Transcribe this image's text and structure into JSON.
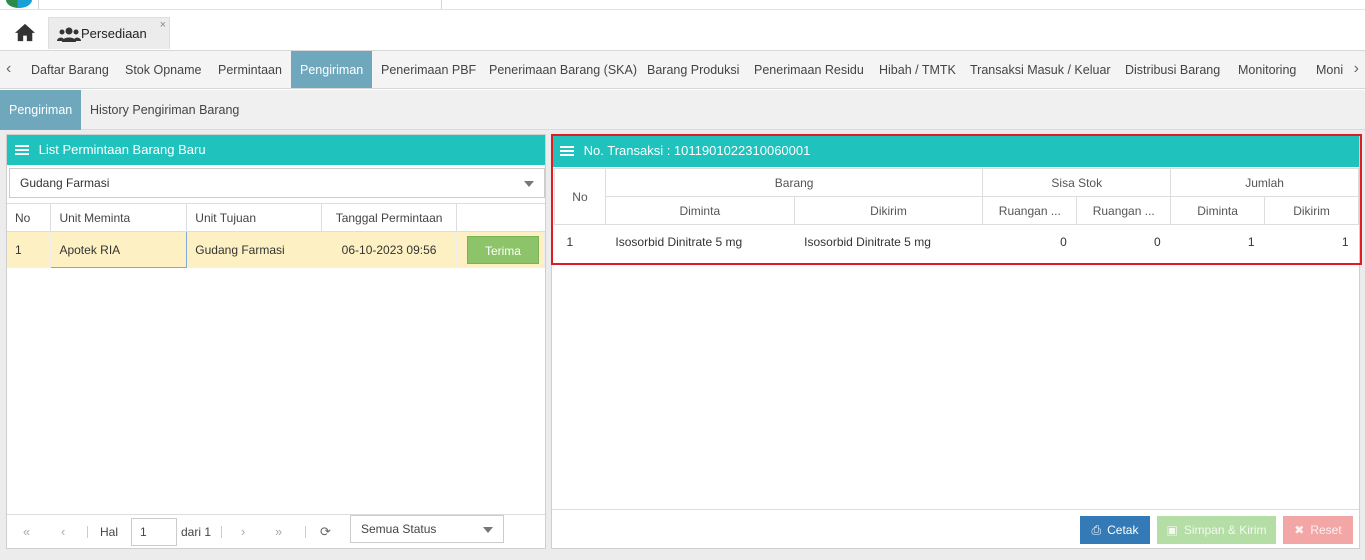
{
  "app": {
    "main_tab": {
      "label": "Persediaan",
      "close": "×"
    },
    "icons": {
      "home": "home-icon",
      "users": "users-icon",
      "close": "close-icon",
      "list": "list-icon",
      "print": "print-icon",
      "save": "save-icon",
      "reset": "close-icon"
    }
  },
  "nav": {
    "items": [
      "Daftar Barang",
      "Stok Opname",
      "Permintaan",
      "Pengiriman",
      "Penerimaan PBF",
      "Penerimaan Barang (SKA)",
      "Barang Produksi",
      "Penerimaan Residu",
      "Hibah / TMTK",
      "Transaksi Masuk / Keluar",
      "Distribusi Barang",
      "Monitoring",
      "Moni"
    ],
    "active": "Pengiriman"
  },
  "subnav": {
    "items": [
      "Pengiriman",
      "History Pengiriman Barang"
    ],
    "active": "Pengiriman"
  },
  "left_panel": {
    "title": "List Permintaan Barang Baru",
    "warehouse_select": "Gudang Farmasi",
    "columns": [
      "No",
      "Unit Meminta",
      "Unit Tujuan",
      "Tanggal Permintaan",
      ""
    ],
    "rows": [
      {
        "no": "1",
        "unit_meminta": "Apotek RIA",
        "unit_tujuan": "Gudang Farmasi",
        "tanggal": "06-10-2023 09:56",
        "action": "Terima"
      }
    ],
    "pager": {
      "hal_label": "Hal",
      "page": "1",
      "dari_label": "dari 1",
      "status_select": "Semua Status"
    }
  },
  "right_panel": {
    "title": "No. Transaksi : 1011901022310060001",
    "group_headers": {
      "no": "No",
      "barang": "Barang",
      "sisa_stok": "Sisa Stok",
      "jumlah": "Jumlah"
    },
    "sub_headers": {
      "diminta": "Diminta",
      "dikirim": "Dikirim",
      "ruangan1": "Ruangan ...",
      "ruangan2": "Ruangan ...",
      "jml_diminta": "Diminta",
      "jml_dikirim": "Dikirim"
    },
    "rows": [
      {
        "no": "1",
        "barang_diminta": "Isosorbid Dinitrate 5 mg",
        "barang_dikirim": "Isosorbid Dinitrate 5 mg",
        "stok1": "0",
        "stok2": "0",
        "jml_diminta": "1",
        "jml_dikirim": "1"
      }
    ],
    "buttons": {
      "cetak": "Cetak",
      "simpan": "Simpan & Kirim",
      "reset": "Reset"
    }
  }
}
